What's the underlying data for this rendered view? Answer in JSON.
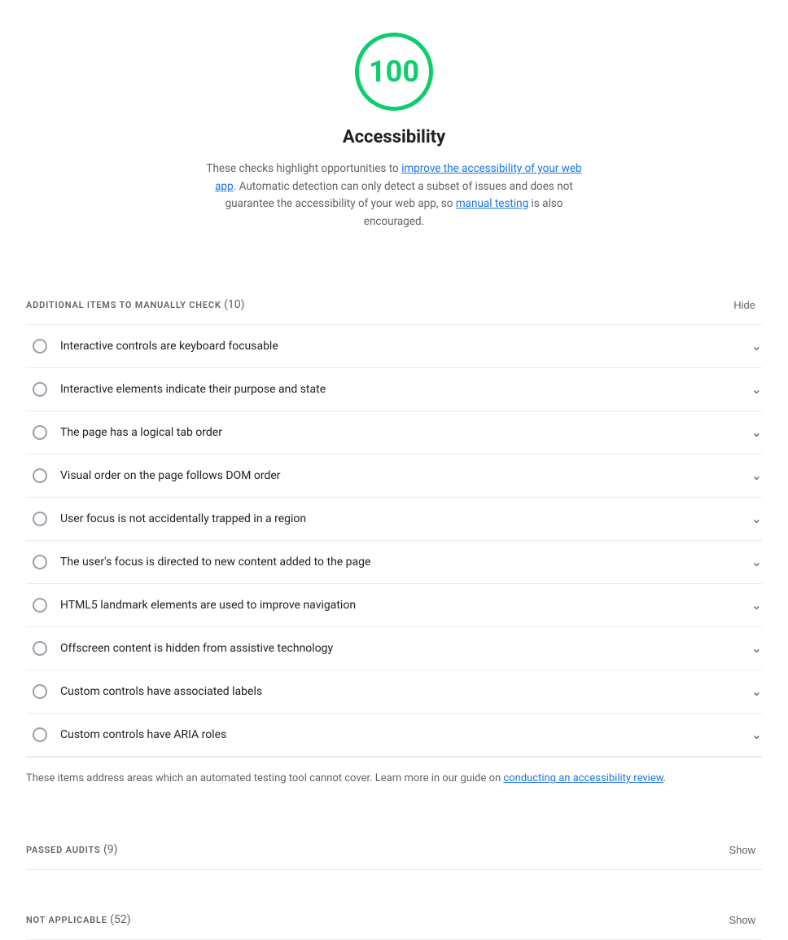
{
  "score": {
    "value": "100",
    "label": "Accessibility",
    "description_text": "These checks highlight opportunities to ",
    "link1_text": "improve the accessibility of your web app",
    "link1_href": "#",
    "description_middle": ". Automatic detection can only detect a subset of issues and does not guarantee the accessibility of your web app, so ",
    "link2_text": "manual testing",
    "link2_href": "#",
    "description_end": " is also encouraged."
  },
  "manual_check_section": {
    "title": "ADDITIONAL ITEMS TO MANUALLY CHECK",
    "count": "(10)",
    "toggle_label": "Hide"
  },
  "audit_items": [
    {
      "label": "Interactive controls are keyboard focusable"
    },
    {
      "label": "Interactive elements indicate their purpose and state"
    },
    {
      "label": "The page has a logical tab order"
    },
    {
      "label": "Visual order on the page follows DOM order"
    },
    {
      "label": "User focus is not accidentally trapped in a region"
    },
    {
      "label": "The user's focus is directed to new content added to the page"
    },
    {
      "label": "HTML5 landmark elements are used to improve navigation"
    },
    {
      "label": "Offscreen content is hidden from assistive technology"
    },
    {
      "label": "Custom controls have associated labels"
    },
    {
      "label": "Custom controls have ARIA roles"
    }
  ],
  "manual_check_note": {
    "text_before": "These items address areas which an automated testing tool cannot cover. Learn more in our guide on ",
    "link_text": "conducting an accessibility review",
    "link_href": "#",
    "text_after": "."
  },
  "passed_audits": {
    "title": "PASSED AUDITS",
    "count": "(9)",
    "toggle_label": "Show"
  },
  "not_applicable": {
    "title": "NOT APPLICABLE",
    "count": "(52)",
    "toggle_label": "Show"
  }
}
